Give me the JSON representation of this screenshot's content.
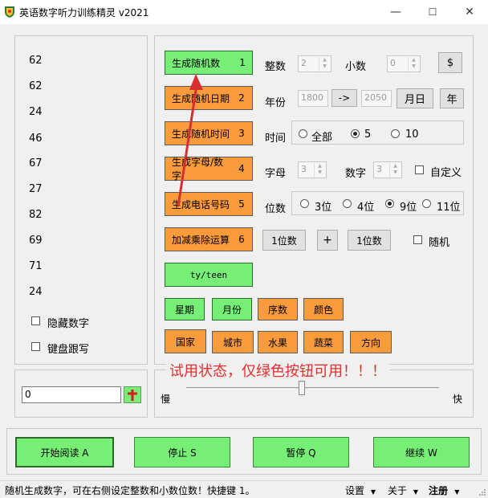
{
  "window": {
    "title": "英语数字听力训练精灵 v2021",
    "minimize": "—",
    "maximize": "☐",
    "close": "✕"
  },
  "numbers": [
    "62",
    "62",
    "24",
    "46",
    "67",
    "27",
    "82",
    "69",
    "71",
    "24"
  ],
  "left_options": {
    "hide_numbers": "隐藏数字",
    "keyboard_follow": "键盘跟写"
  },
  "input_box": {
    "value": "0"
  },
  "buttons": {
    "random_number": "生成随机数",
    "random_number_key": "1",
    "random_date": "生成随机日期",
    "random_date_key": "2",
    "random_time": "生成随机时间",
    "random_time_key": "3",
    "letter_number": "生成字母/数字",
    "letter_number_key": "4",
    "phone": "生成电话号码",
    "phone_key": "5",
    "arith": "加减乘除运算",
    "arith_key": "6",
    "ty_teen": "ty/teen"
  },
  "row1": {
    "integer_label": "整数",
    "integer_value": "2",
    "decimal_label": "小数",
    "decimal_value": "0",
    "dollar": "$"
  },
  "row2": {
    "year_label": "年份",
    "from": "1800",
    "arrow": "->",
    "to": "2050",
    "month_day": "月日",
    "year": "年"
  },
  "row3": {
    "time_label": "时间",
    "all": "全部",
    "five": "5",
    "ten": "10"
  },
  "row4": {
    "letter_label": "字母",
    "letter_value": "3",
    "digit_label": "数字",
    "digit_value": "3",
    "custom": "自定义"
  },
  "row5": {
    "digits_label": "位数",
    "d3": "3位",
    "d4": "4位",
    "d9": "9位",
    "d11": "11位"
  },
  "row6": {
    "op1": "1位数",
    "plus": "+",
    "op2": "1位数",
    "random": "随机"
  },
  "categories_row1": [
    "星期",
    "月份",
    "序数",
    "颜色"
  ],
  "categories_row2": [
    "国家",
    "城市",
    "水果",
    "蔬菜",
    "方向"
  ],
  "trial_notice": "试用状态，仅绿色按钮可用！！！",
  "speed": {
    "slow": "慢",
    "fast": "快"
  },
  "bottom": {
    "start": "开始阅读 A",
    "stop": "停止 S",
    "pause": "暂停 Q",
    "continue": "继续 W"
  },
  "status": {
    "text": "随机生成数字，可在右侧设定整数和小数位数！快捷键 1。",
    "settings": "设置",
    "about": "关于",
    "register": "注册"
  },
  "colors": {
    "green": "#77ef77",
    "orange": "#fb9c3c",
    "notice_red": "#e53030",
    "arrow_red": "#d63030"
  }
}
